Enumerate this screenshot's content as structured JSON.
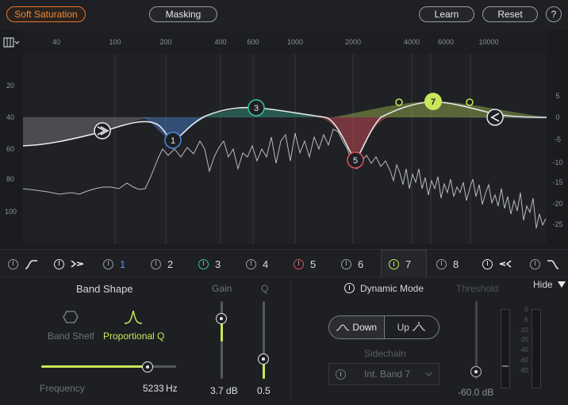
{
  "toolbar": {
    "mode_label": "Soft Saturation",
    "masking_label": "Masking",
    "learn_label": "Learn",
    "reset_label": "Reset",
    "help_label": "?"
  },
  "graph": {
    "freq_labels": [
      "40",
      "100",
      "200",
      "400",
      "600",
      "1000",
      "2000",
      "4000",
      "6000",
      "10000"
    ],
    "db_left_labels": [
      "20",
      "40",
      "60",
      "80",
      "100"
    ],
    "db_right_labels": [
      "5",
      "0",
      "-5",
      "-10",
      "-15",
      "-20",
      "-25"
    ],
    "nodes": [
      "1",
      "3",
      "5",
      "7"
    ],
    "colors": {
      "band1": "#4b86d8",
      "band3": "#38c0a0",
      "band5": "#e0505a",
      "band7": "#c9e75a"
    }
  },
  "bands": [
    {
      "label": "",
      "icon": "highpass-icon"
    },
    {
      "label": "",
      "icon": "low-shelf-icon"
    },
    {
      "label": "1",
      "color": "#4b86d8"
    },
    {
      "label": "2"
    },
    {
      "label": "3",
      "color": "#38c0a0"
    },
    {
      "label": "4"
    },
    {
      "label": "5",
      "color": "#e0505a"
    },
    {
      "label": "6"
    },
    {
      "label": "7",
      "color": "#c9e75a"
    },
    {
      "label": "8"
    },
    {
      "label": "",
      "icon": "high-shelf-icon"
    },
    {
      "label": "",
      "icon": "lowpass-icon"
    }
  ],
  "panel": {
    "band_shape_title": "Band Shape",
    "band_shelf_label": "Band Shelf",
    "proportional_q_label": "Proportional Q",
    "frequency_label": "Frequency",
    "frequency_value": "5233",
    "frequency_unit": "Hz",
    "gain_label": "Gain",
    "gain_value": "3.7 dB",
    "q_label": "Q",
    "q_value": "0.5",
    "dynamic_mode_label": "Dynamic Mode",
    "down_label": "Down",
    "up_label": "Up",
    "sidechain_label": "Sidechain",
    "sidechain_source": "Int. Band 7",
    "threshold_label": "Threshold",
    "threshold_value": "-60.0 dB",
    "hide_label": "Hide",
    "meter_labels": [
      "0",
      "-5",
      "-10",
      "-20",
      "-40",
      "-60",
      "-80"
    ],
    "frequency_slider_level": 0.79,
    "gain_level": 0.3,
    "q_level": 0.38,
    "threshold_level": 0.12
  }
}
